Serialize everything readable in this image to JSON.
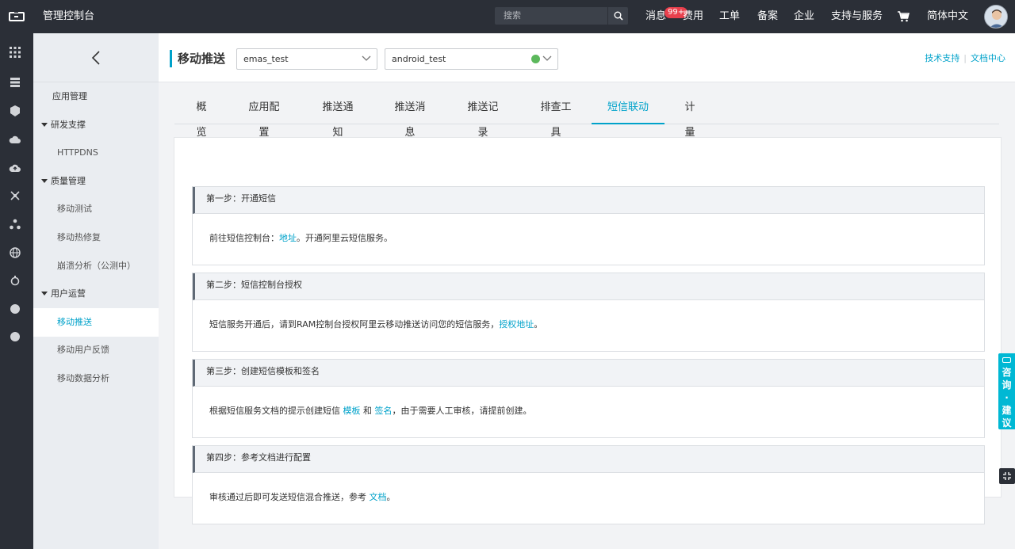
{
  "topbar": {
    "console_title": "管理控制台",
    "search_placeholder": "搜索",
    "nav": {
      "messages": "消息",
      "messages_badge": "99+",
      "billing": "费用",
      "tickets": "工单",
      "icp": "备案",
      "enterprise": "企业",
      "support": "支持与服务",
      "language": "简体中文"
    },
    "colors": {
      "bg": "#2b2f37",
      "badge": "#e8404d"
    }
  },
  "rail": {
    "icons": [
      "grid-icon",
      "list-icon",
      "cube-icon",
      "cloud-icon",
      "cloud-upload-icon",
      "network-icon",
      "cluster-icon",
      "globe-icon",
      "settings-icon",
      "circle-icon",
      "circle-icon"
    ]
  },
  "sidebar": {
    "items": [
      {
        "label": "应用管理",
        "kind": "l1"
      },
      {
        "label": "研发支撑",
        "kind": "group"
      },
      {
        "label": "HTTPDNS",
        "kind": "l2"
      },
      {
        "label": "质量管理",
        "kind": "group"
      },
      {
        "label": "移动测试",
        "kind": "l2"
      },
      {
        "label": "移动热修复",
        "kind": "l2"
      },
      {
        "label": "崩溃分析（公测中）",
        "kind": "l2"
      },
      {
        "label": "用户运营",
        "kind": "group"
      },
      {
        "label": "移动推送",
        "kind": "l2",
        "active": true
      },
      {
        "label": "移动用户反馈",
        "kind": "l2"
      },
      {
        "label": "移动数据分析",
        "kind": "l2"
      }
    ]
  },
  "header": {
    "title": "移动推送",
    "project_select": "emas_test",
    "app_select": "android_test",
    "links": {
      "tech_support": "技术支持",
      "docs": "文档中心"
    },
    "accent": "#00a2ca"
  },
  "tabs": [
    {
      "label": "概览"
    },
    {
      "label": "应用配置"
    },
    {
      "label": "推送通知"
    },
    {
      "label": "推送消息"
    },
    {
      "label": "推送记录"
    },
    {
      "label": "排查工具"
    },
    {
      "label": "短信联动",
      "active": true
    },
    {
      "label": "计量"
    }
  ],
  "steps": [
    {
      "title": "第一步：开通短信",
      "text_before": "前往短信控制台：",
      "link1": "地址",
      "text_middle": "。开通阿里云短信服务。",
      "link2": "",
      "text_after": ""
    },
    {
      "title": "第二步：短信控制台授权",
      "text_before": "短信服务开通后，请到RAM控制台授权阿里云移动推送访问您的短信服务，",
      "link1": "授权地址",
      "text_middle": "。",
      "link2": "",
      "text_after": ""
    },
    {
      "title": "第三步：创建短信模板和签名",
      "text_before": "根据短信服务文档的提示创建短信 ",
      "link1": "模板",
      "text_middle": " 和 ",
      "link2": "签名",
      "text_after": "，由于需要人工审核，请提前创建。"
    },
    {
      "title": "第四步：参考文档进行配置",
      "text_before": "审核通过后即可发送短信混合推送，参考 ",
      "link1": "文档",
      "text_middle": "。",
      "link2": "",
      "text_after": ""
    }
  ],
  "feedback": {
    "label": "咨询·建议"
  }
}
